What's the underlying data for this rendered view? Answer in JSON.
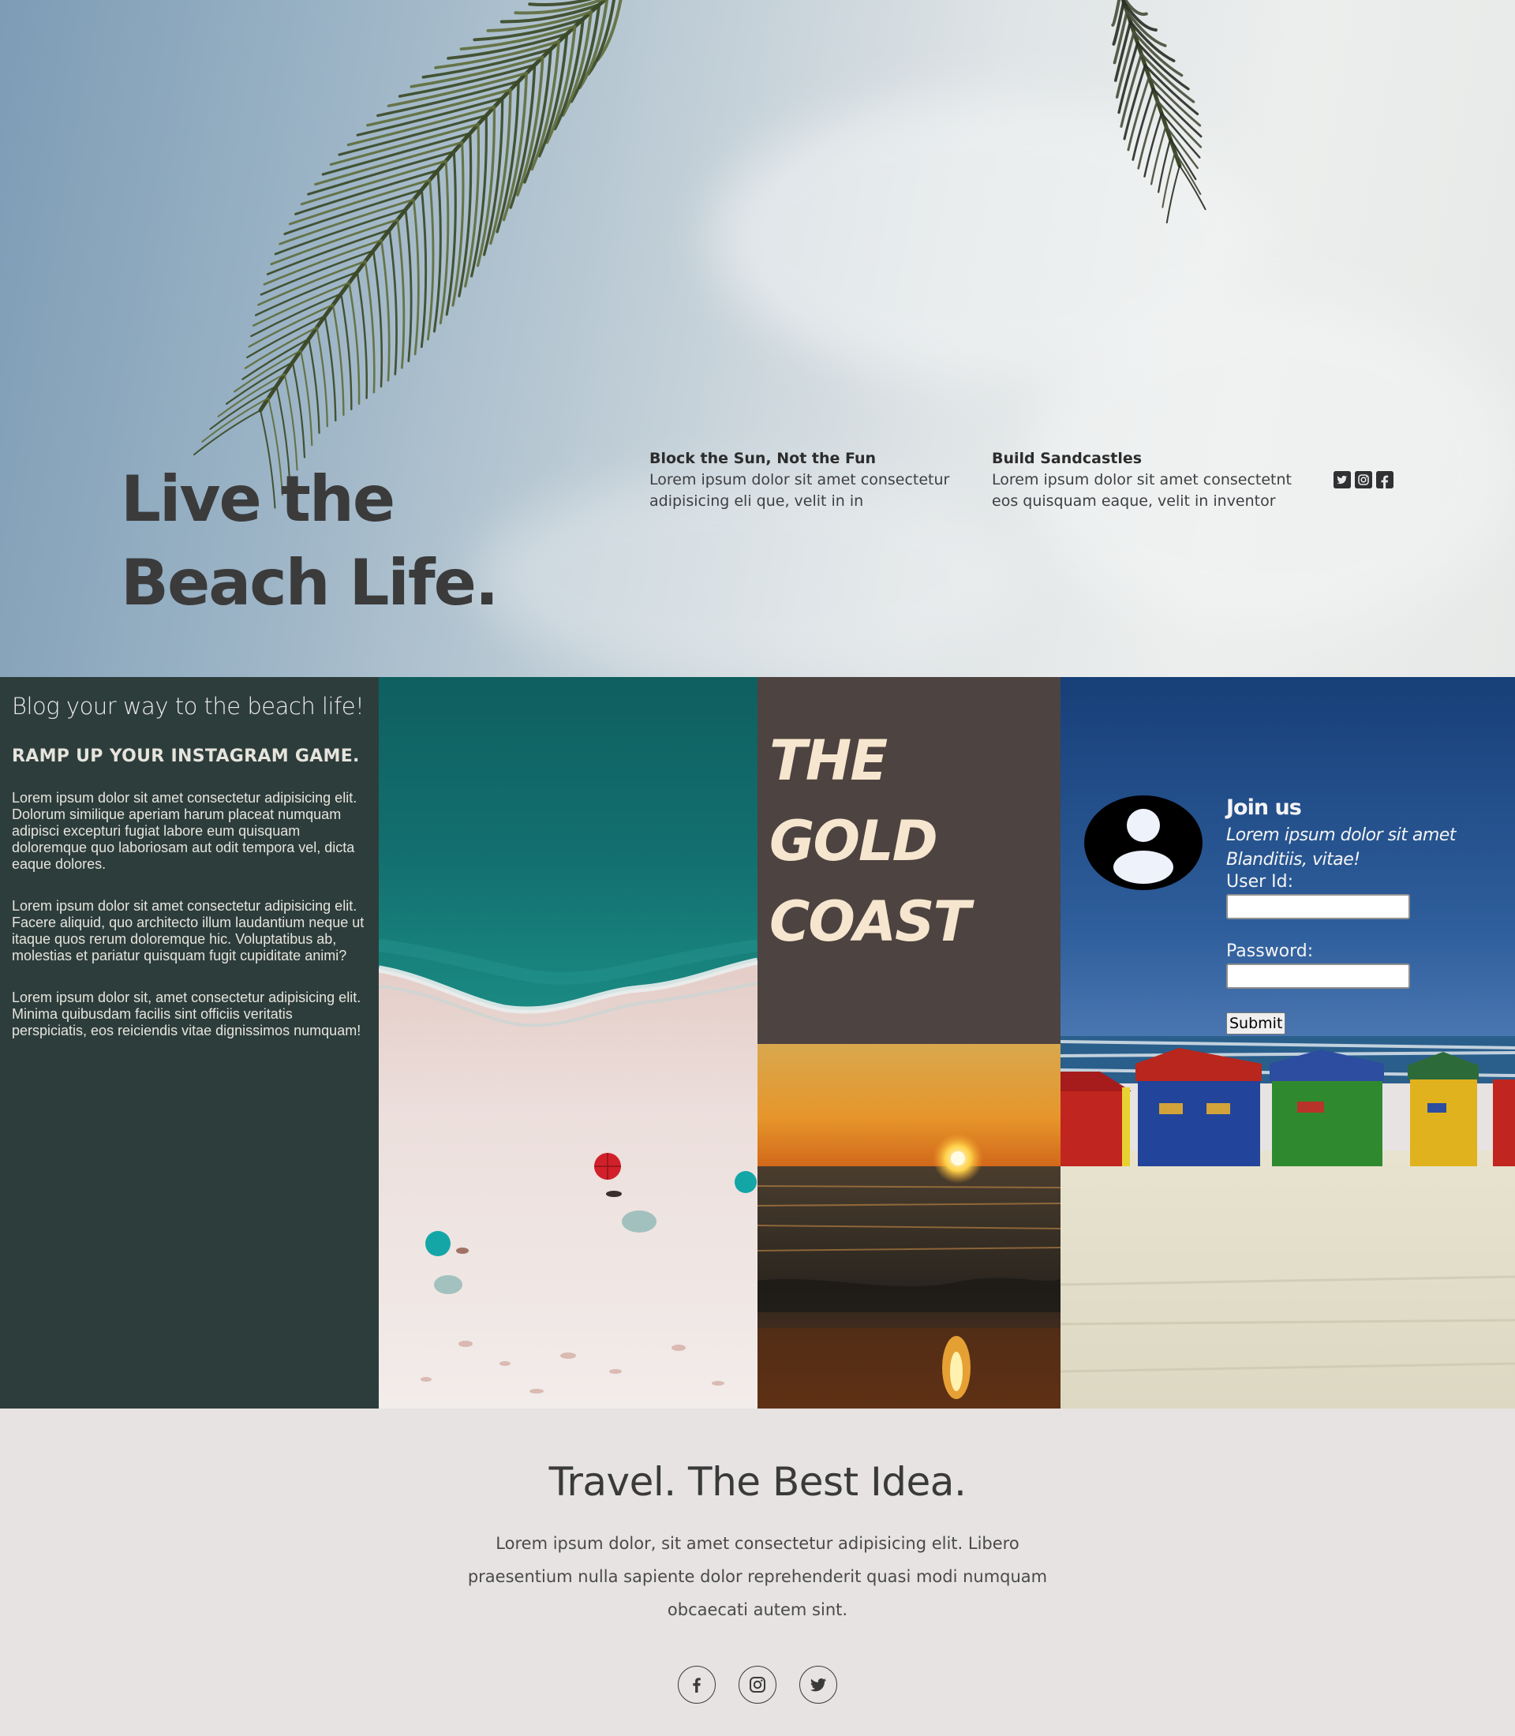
{
  "hero": {
    "title": "Live the Beach Life.",
    "features": [
      {
        "title": "Block the Sun, Not the Fun",
        "text": "Lorem ipsum dolor sit amet consectetur adipisicing eli que, velit in in"
      },
      {
        "title": "Build Sandcastles",
        "text": "Lorem ipsum dolor sit amet consectetnt eos quisquam eaque, velit in inventor"
      }
    ],
    "social_icons": [
      "twitter-square-icon",
      "instagram-square-icon",
      "facebook-square-icon"
    ]
  },
  "blog": {
    "title": "Blog your way to the beach life!",
    "subtitle": "RAMP UP YOUR INSTAGRAM GAME.",
    "paragraphs": [
      "Lorem ipsum dolor sit amet consectetur adipisicing elit. Dolorum similique aperiam harum placeat numquam adipisci excepturi fugiat labore eum quisquam doloremque quo laboriosam aut odit tempora vel, dicta eaque dolores.",
      "Lorem ipsum dolor sit amet consectetur adipisicing elit. Facere aliquid, quo architecto illum laudantium neque ut itaque quos rerum doloremque hic. Voluptatibus ab, molestias et pariatur quisquam fugit cupiditate animi?",
      "Lorem ipsum dolor sit, amet consectetur adipisicing elit. Minima quibusdam facilis sint officiis veritatis perspiciatis, eos reiciendis vitae dignissimos numquam!"
    ]
  },
  "gold_coast": {
    "title": "THE GOLD COAST"
  },
  "join": {
    "heading": "Join us",
    "tagline": "Lorem ipsum dolor sit amet Blanditiis, vitae!",
    "user_label": "User Id:",
    "user_value": "",
    "password_label": "Password:",
    "password_value": "",
    "submit_label": "Submit"
  },
  "footer": {
    "title": "Travel. The Best Idea.",
    "text": "Lorem ipsum dolor, sit amet consectetur adipisicing elit. Libero praesentium nulla sapiente dolor reprehenderit quasi modi numquam obcaecati autem sint.",
    "social_icons": [
      "facebook-icon",
      "instagram-icon",
      "twitter-icon"
    ]
  },
  "colors": {
    "blog_bg": "#2d3d3c",
    "gold_bg": "#4d4340",
    "gold_text": "#f7e6cf",
    "footer_bg": "#e6e3e2"
  }
}
